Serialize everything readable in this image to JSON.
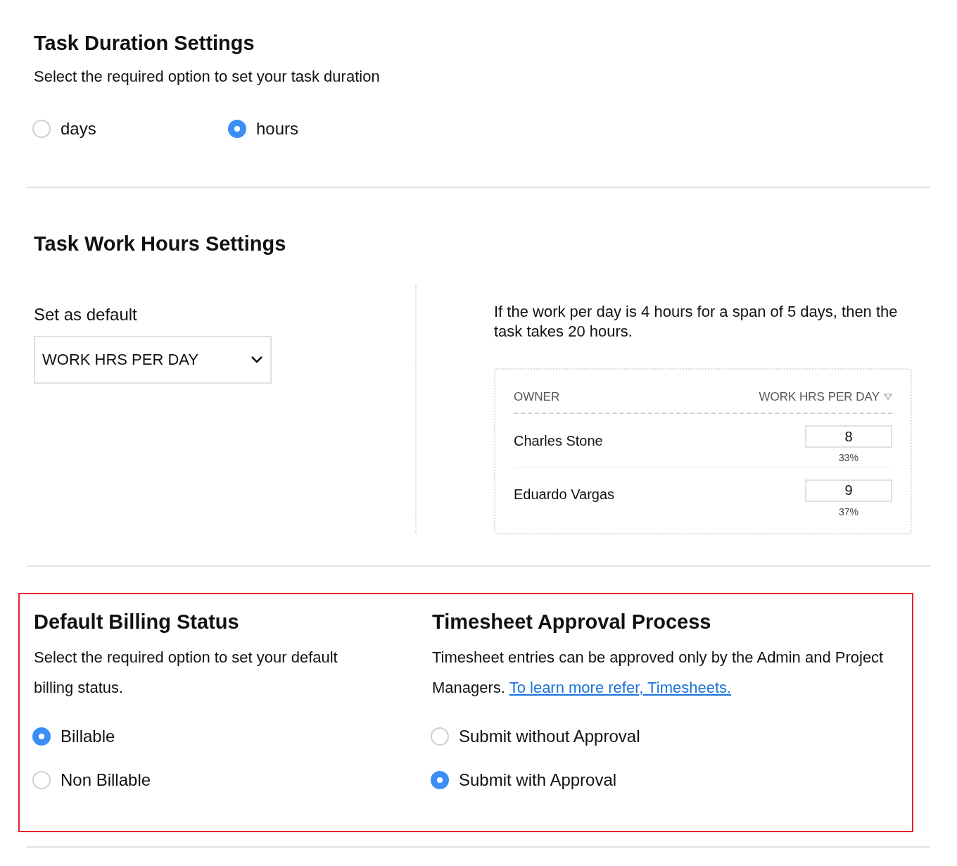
{
  "duration": {
    "title": "Task Duration Settings",
    "subtitle": "Select the required option to set your task duration",
    "options": [
      {
        "label": "days",
        "selected": false
      },
      {
        "label": "hours",
        "selected": true
      }
    ]
  },
  "work_hours": {
    "title": "Task Work Hours Settings",
    "default_label": "Set as default",
    "dropdown": {
      "value": "WORK HRS PER DAY"
    },
    "explanation": "If the work per day is 4 hours for a span of 5 days, then the task takes 20 hours.",
    "table": {
      "columns": [
        "OWNER",
        "WORK HRS PER DAY"
      ],
      "rows": [
        {
          "owner": "Charles Stone",
          "hours": "8",
          "percent": "33%"
        },
        {
          "owner": "Eduardo Vargas",
          "hours": "9",
          "percent": "37%"
        }
      ]
    }
  },
  "billing": {
    "title": "Default Billing Status",
    "description": "Select the required option to set your default billing status.",
    "options": [
      {
        "label": "Billable",
        "selected": true
      },
      {
        "label": "Non Billable",
        "selected": false
      }
    ]
  },
  "approval": {
    "title": "Timesheet Approval Process",
    "description": "Timesheet entries can be approved only by the Admin and Project Managers.",
    "link": "To learn more refer, Timesheets.",
    "options": [
      {
        "label": "Submit without Approval",
        "selected": false
      },
      {
        "label": "Submit with Approval",
        "selected": true
      }
    ]
  }
}
